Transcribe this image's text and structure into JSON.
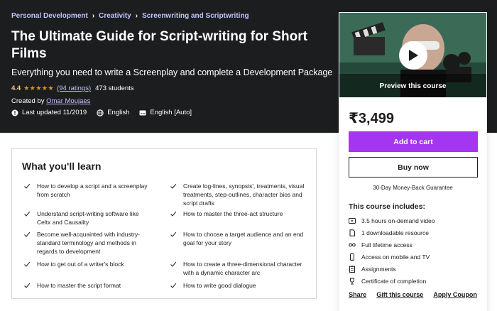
{
  "breadcrumb": [
    "Personal Development",
    "Creativity",
    "Screenwriting and Scriptwriting"
  ],
  "course": {
    "title": "The Ultimate Guide for Script-writing for Short Films",
    "subtitle": "Everything you need to write a Screenplay and complete a Development Package",
    "rating": "4.4",
    "ratings_count": "(94 ratings)",
    "students": "473 students",
    "created_by_label": "Created by",
    "author": "Omar Moujaes",
    "last_updated": "Last updated 11/2019",
    "language": "English",
    "captions": "English [Auto]"
  },
  "sidebar": {
    "preview_label": "Preview this course",
    "price": "₹3,499",
    "add_to_cart": "Add to cart",
    "buy_now": "Buy now",
    "guarantee": "30-Day Money-Back Guarantee",
    "includes_title": "This course includes:",
    "includes": [
      {
        "icon": "video-icon",
        "text": "3.5 hours on-demand video"
      },
      {
        "icon": "file-icon",
        "text": "1 downloadable resource"
      },
      {
        "icon": "infinity-icon",
        "text": "Full lifetime access"
      },
      {
        "icon": "mobile-icon",
        "text": "Access on mobile and TV"
      },
      {
        "icon": "assignment-icon",
        "text": "Assignments"
      },
      {
        "icon": "trophy-icon",
        "text": "Certificate of completion"
      }
    ],
    "share": "Share",
    "gift": "Gift this course",
    "coupon": "Apply Coupon"
  },
  "learn": {
    "title": "What you'll learn",
    "items": [
      "How to develop a script and a screenplay from scratch",
      "Create log-lines, synopsis', treatments, visual treatments, step-outlines, character bios and script drafts",
      "Understand script-writing software like Celtx and Causality",
      "How to master the three-act structure",
      "Become well-acquainted with industry-standard terminology and methods in regards to development",
      "How to choose a target audience and an end goal for your story",
      "How to get out of a writer's block",
      "How to create a three-dimensional character with a dynamic character arc",
      "How to master the script format",
      "How to write good dialogue"
    ]
  },
  "colors": {
    "hero_bg": "#1c1d1f",
    "link_purple": "#c0c4fc",
    "accent_purple": "#a435f0",
    "star_orange": "#e59819",
    "rating_gold": "#f3ca8c"
  }
}
